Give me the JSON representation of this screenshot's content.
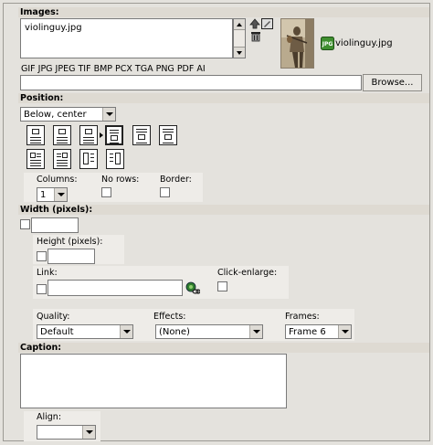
{
  "images": {
    "header": "Images:",
    "file_list": [
      "violinguy.jpg"
    ],
    "thumbnail_caption": "violinguy.jpg",
    "file_types": "GIF JPG JPEG TIF BMP PCX TGA PNG PDF AI",
    "upload_value": "",
    "browse_label": "Browse..."
  },
  "position": {
    "header": "Position:",
    "selected": "Below, center",
    "columns_label": "Columns:",
    "columns_value": "1",
    "norows_label": "No rows:",
    "border_label": "Border:"
  },
  "width": {
    "header": "Width (pixels):",
    "height_label": "Height (pixels):",
    "link_label": "Link:",
    "click_enlarge_label": "Click-enlarge:",
    "quality_label": "Quality:",
    "quality_value": "Default",
    "effects_label": "Effects:",
    "effects_value": "(None)",
    "frames_label": "Frames:",
    "frames_value": "Frame 6"
  },
  "caption": {
    "header": "Caption:",
    "align_label": "Align:",
    "align_value": ""
  },
  "colors": {
    "panel": "#e4e2dd",
    "header": "#dedad2",
    "border": "#7a7a7a"
  },
  "icons": [
    "arrow-up-icon",
    "edit-icon",
    "trash-icon",
    "jpg-file-icon",
    "link-chain-icon",
    "dropdown-arrow-icon"
  ]
}
